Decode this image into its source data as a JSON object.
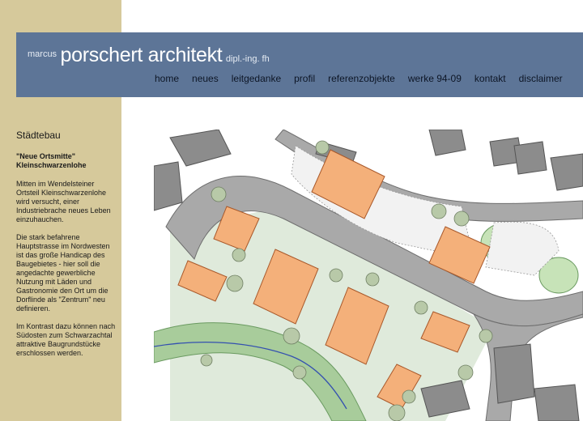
{
  "header": {
    "name_prefix": "marcus",
    "name_main": "porschert architekt",
    "name_suffix": "dipl.-ing. fh"
  },
  "nav": [
    "home",
    "neues",
    "leitgedanke",
    "profil",
    "referenzobjekte",
    "werke 94-09",
    "kontakt",
    "disclaimer"
  ],
  "sidebar": {
    "heading": "Städtebau",
    "project_title_line1": "\"Neue Ortsmitte\"",
    "project_title_line2": "Kleinschwarzenlohe",
    "paragraphs": [
      "Mitten im Wendelsteiner Ortsteil Kleinschwarzenlohe wird versucht, einer Industriebrache neues Leben einzuhauchen.",
      "Die stark befahrene Hauptstrasse im Nordwesten ist das große Handicap des Baugebietes - hier soll die angedachte gewerbliche Nutzung mit Läden und Gastronomie den Ort um die Dorflinde als \"Zentrum\" neu definieren.",
      "Im Kontrast dazu können nach Südosten zum Schwarzachtal attraktive Baugrundstücke erschlossen werden."
    ]
  },
  "colors": {
    "sidebar": "#d6c99b",
    "header": "#5d7597",
    "road": "#a9a9a9",
    "building": "#f4b07a",
    "river": "#a8cc9b",
    "green": "#d4e3c8"
  }
}
